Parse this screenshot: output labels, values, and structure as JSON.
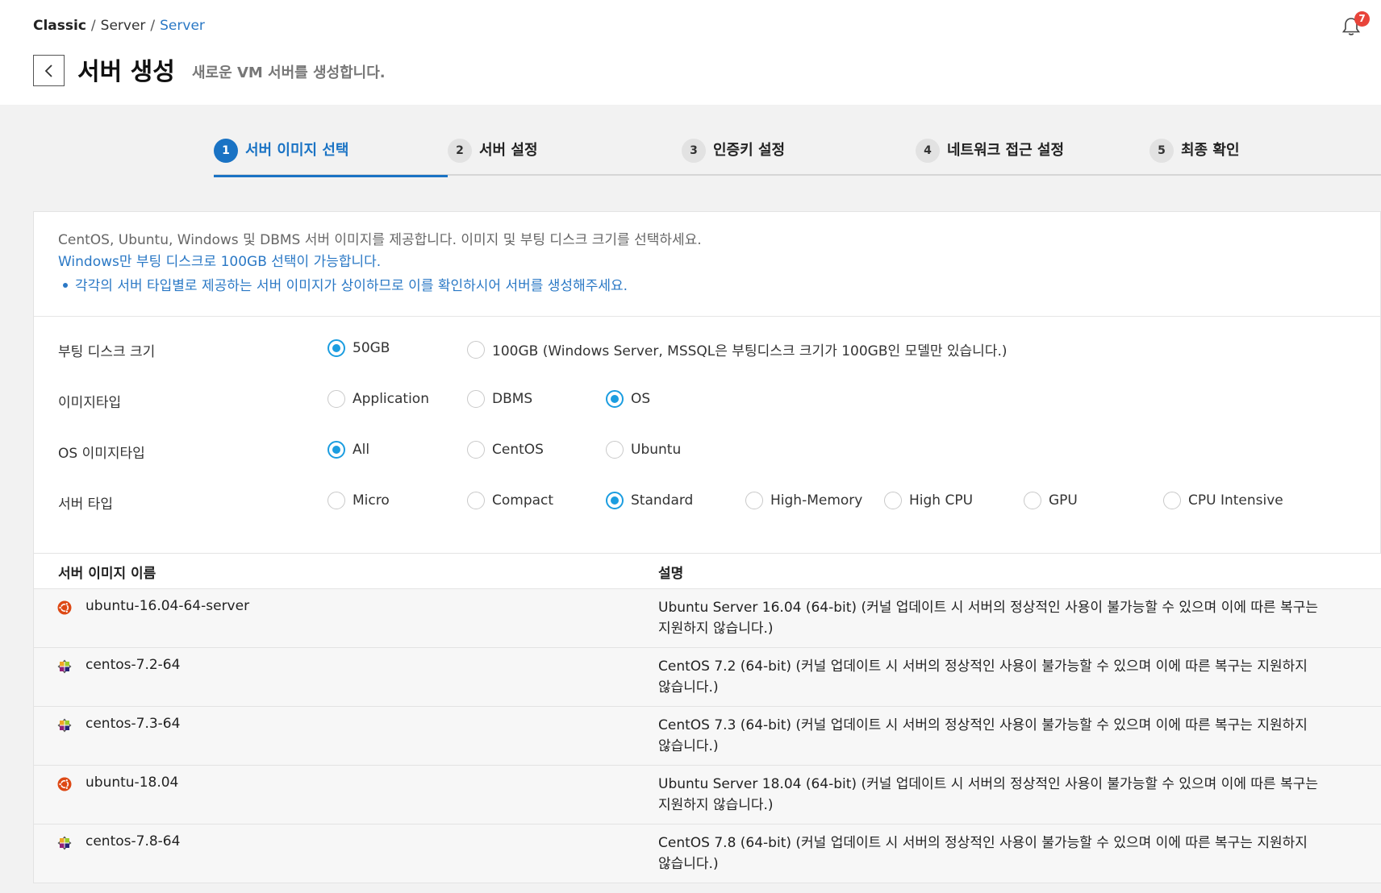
{
  "breadcrumb": {
    "root": "Classic",
    "middle": "Server",
    "current": "Server"
  },
  "notifications": {
    "count": "7",
    "icon": "bell-icon"
  },
  "header": {
    "title": "서버 생성",
    "subtitle": "새로운 VM 서버를 생성합니다."
  },
  "steps": [
    {
      "num": "1",
      "label": "서버 이미지 선택",
      "active": true
    },
    {
      "num": "2",
      "label": "서버 설정"
    },
    {
      "num": "3",
      "label": "인증키 설정"
    },
    {
      "num": "4",
      "label": "네트워크 접근 설정"
    },
    {
      "num": "5",
      "label": "최종 확인"
    }
  ],
  "info": {
    "line1": "CentOS, Ubuntu, Windows 및 DBMS 서버 이미지를 제공합니다. 이미지 및 부팅 디스크 크기를 선택하세요.",
    "line2": "Windows만 부팅 디스크로 100GB 선택이 가능합니다.",
    "line3": "각각의 서버 타입별로 제공하는 서버 이미지가 상이하므로 이를 확인하시어 서버를 생성해주세요."
  },
  "options": {
    "boot_disk": {
      "label": "부팅 디스크 크기",
      "choices": [
        "50GB",
        "100GB (Windows Server, MSSQL은 부팅디스크 크기가 100GB인 모델만 있습니다.)"
      ],
      "selected": "50GB"
    },
    "image_type": {
      "label": "이미지타입",
      "choices": [
        "Application",
        "DBMS",
        "OS"
      ],
      "selected": "OS"
    },
    "os_image_type": {
      "label": "OS 이미지타입",
      "choices": [
        "All",
        "CentOS",
        "Ubuntu"
      ],
      "selected": "All"
    },
    "server_type": {
      "label": "서버 타입",
      "choices": [
        "Micro",
        "Compact",
        "Standard",
        "High-Memory",
        "High CPU",
        "GPU",
        "CPU Intensive"
      ],
      "selected": "Standard"
    }
  },
  "table": {
    "headers": [
      "서버 이미지 이름",
      "설명"
    ],
    "rows": [
      {
        "icon": "ubuntu-icon",
        "name": "ubuntu-16.04-64-server",
        "desc": "Ubuntu Server 16.04 (64-bit) (커널 업데이트 시 서버의 정상적인 사용이 불가능할 수 있으며 이에 따른 복구는 지원하지 않습니다.)"
      },
      {
        "icon": "centos-icon",
        "name": "centos-7.2-64",
        "desc": "CentOS 7.2 (64-bit) (커널 업데이트 시 서버의 정상적인 사용이 불가능할 수 있으며 이에 따른 복구는 지원하지 않습니다.)"
      },
      {
        "icon": "centos-icon",
        "name": "centos-7.3-64",
        "desc": "CentOS 7.3 (64-bit) (커널 업데이트 시 서버의 정상적인 사용이 불가능할 수 있으며 이에 따른 복구는 지원하지 않습니다.)"
      },
      {
        "icon": "ubuntu-icon",
        "name": "ubuntu-18.04",
        "desc": "Ubuntu Server 18.04 (64-bit) (커널 업데이트 시 서버의 정상적인 사용이 불가능할 수 있으며 이에 따른 복구는 지원하지 않습니다.)"
      },
      {
        "icon": "centos-icon",
        "name": "centos-7.8-64",
        "desc": "CentOS 7.8 (64-bit) (커널 업데이트 시 서버의 정상적인 사용이 불가능할 수 있으며 이에 따른 복구는 지원하지 않습니다.)"
      }
    ]
  },
  "colors": {
    "accent": "#1a73c4",
    "radio": "#1b9de0",
    "link": "#2a78c5",
    "badge": "#e8443a"
  }
}
